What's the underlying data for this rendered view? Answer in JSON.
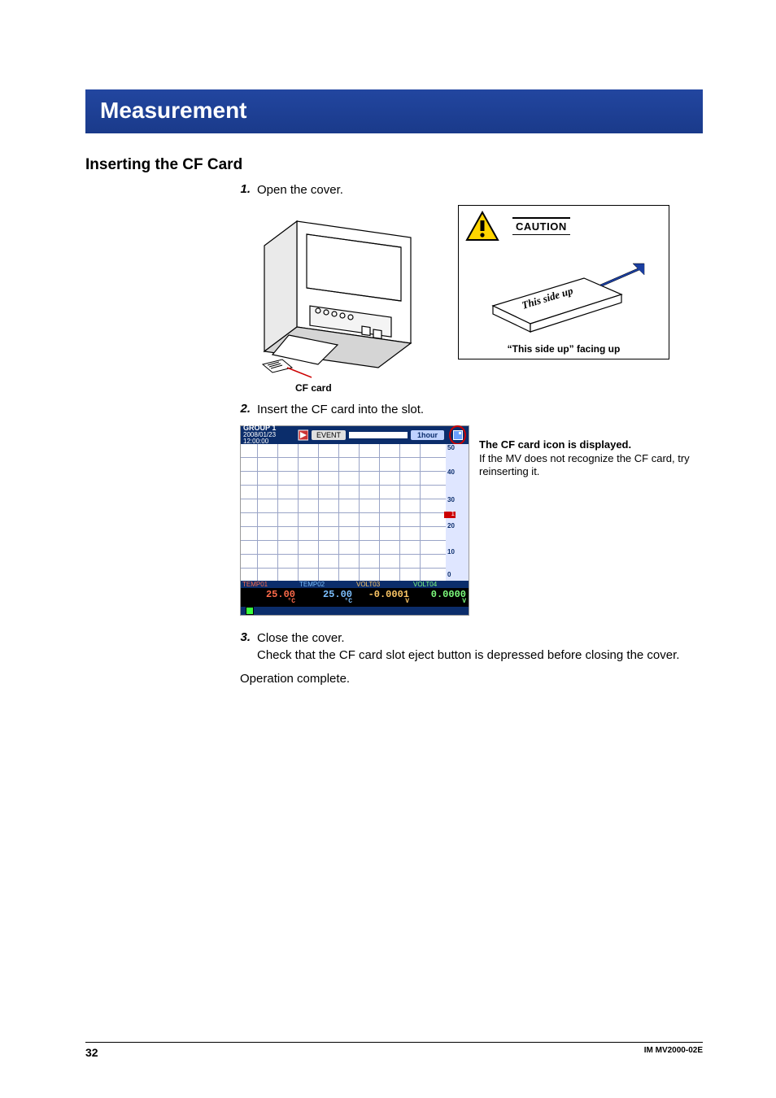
{
  "title": "Measurement",
  "section": "Inserting the CF Card",
  "steps": [
    {
      "num": "1.",
      "text": "Open the cover."
    },
    {
      "num": "2.",
      "text": "Insert the CF card into the slot."
    },
    {
      "num": "3.",
      "text": "Close the cover."
    }
  ],
  "step3_note": "Check that the CF card slot eject button is depressed before closing the cover.",
  "operation_complete": "Operation complete.",
  "fig1": {
    "cf_card_label": "CF card",
    "caution_title": "CAUTION",
    "caution_footer": "“This side up” facing up",
    "card_script": "This side up"
  },
  "screen": {
    "group_line1": "GROUP 1",
    "group_line2": "2008/01/23 12:00:00",
    "event_badge": "EVENT",
    "time_badge": "1hour",
    "scale_ticks": [
      "50",
      "40",
      "30",
      "20",
      "10",
      "0"
    ],
    "scale_marker": "1",
    "channels": [
      {
        "label": "TEMP01",
        "value": "25.00",
        "unit": "°C",
        "colorClass": "red",
        "vclass": "v-red"
      },
      {
        "label": "TEMP02",
        "value": "25.00",
        "unit": "°C",
        "colorClass": "blue",
        "vclass": "v-blue"
      },
      {
        "label": "VOLT03",
        "value": "-0.0001",
        "unit": "V",
        "colorClass": "orange",
        "vclass": "v-orange"
      },
      {
        "label": "VOLT04",
        "value": "0.0000",
        "unit": "V",
        "colorClass": "green",
        "vclass": "v-green"
      }
    ]
  },
  "callout": {
    "bold": "The CF card icon is displayed.",
    "body": "If the MV does not recognize the CF card, try reinserting it."
  },
  "footer": {
    "page": "32",
    "docid": "IM MV2000-02E"
  }
}
